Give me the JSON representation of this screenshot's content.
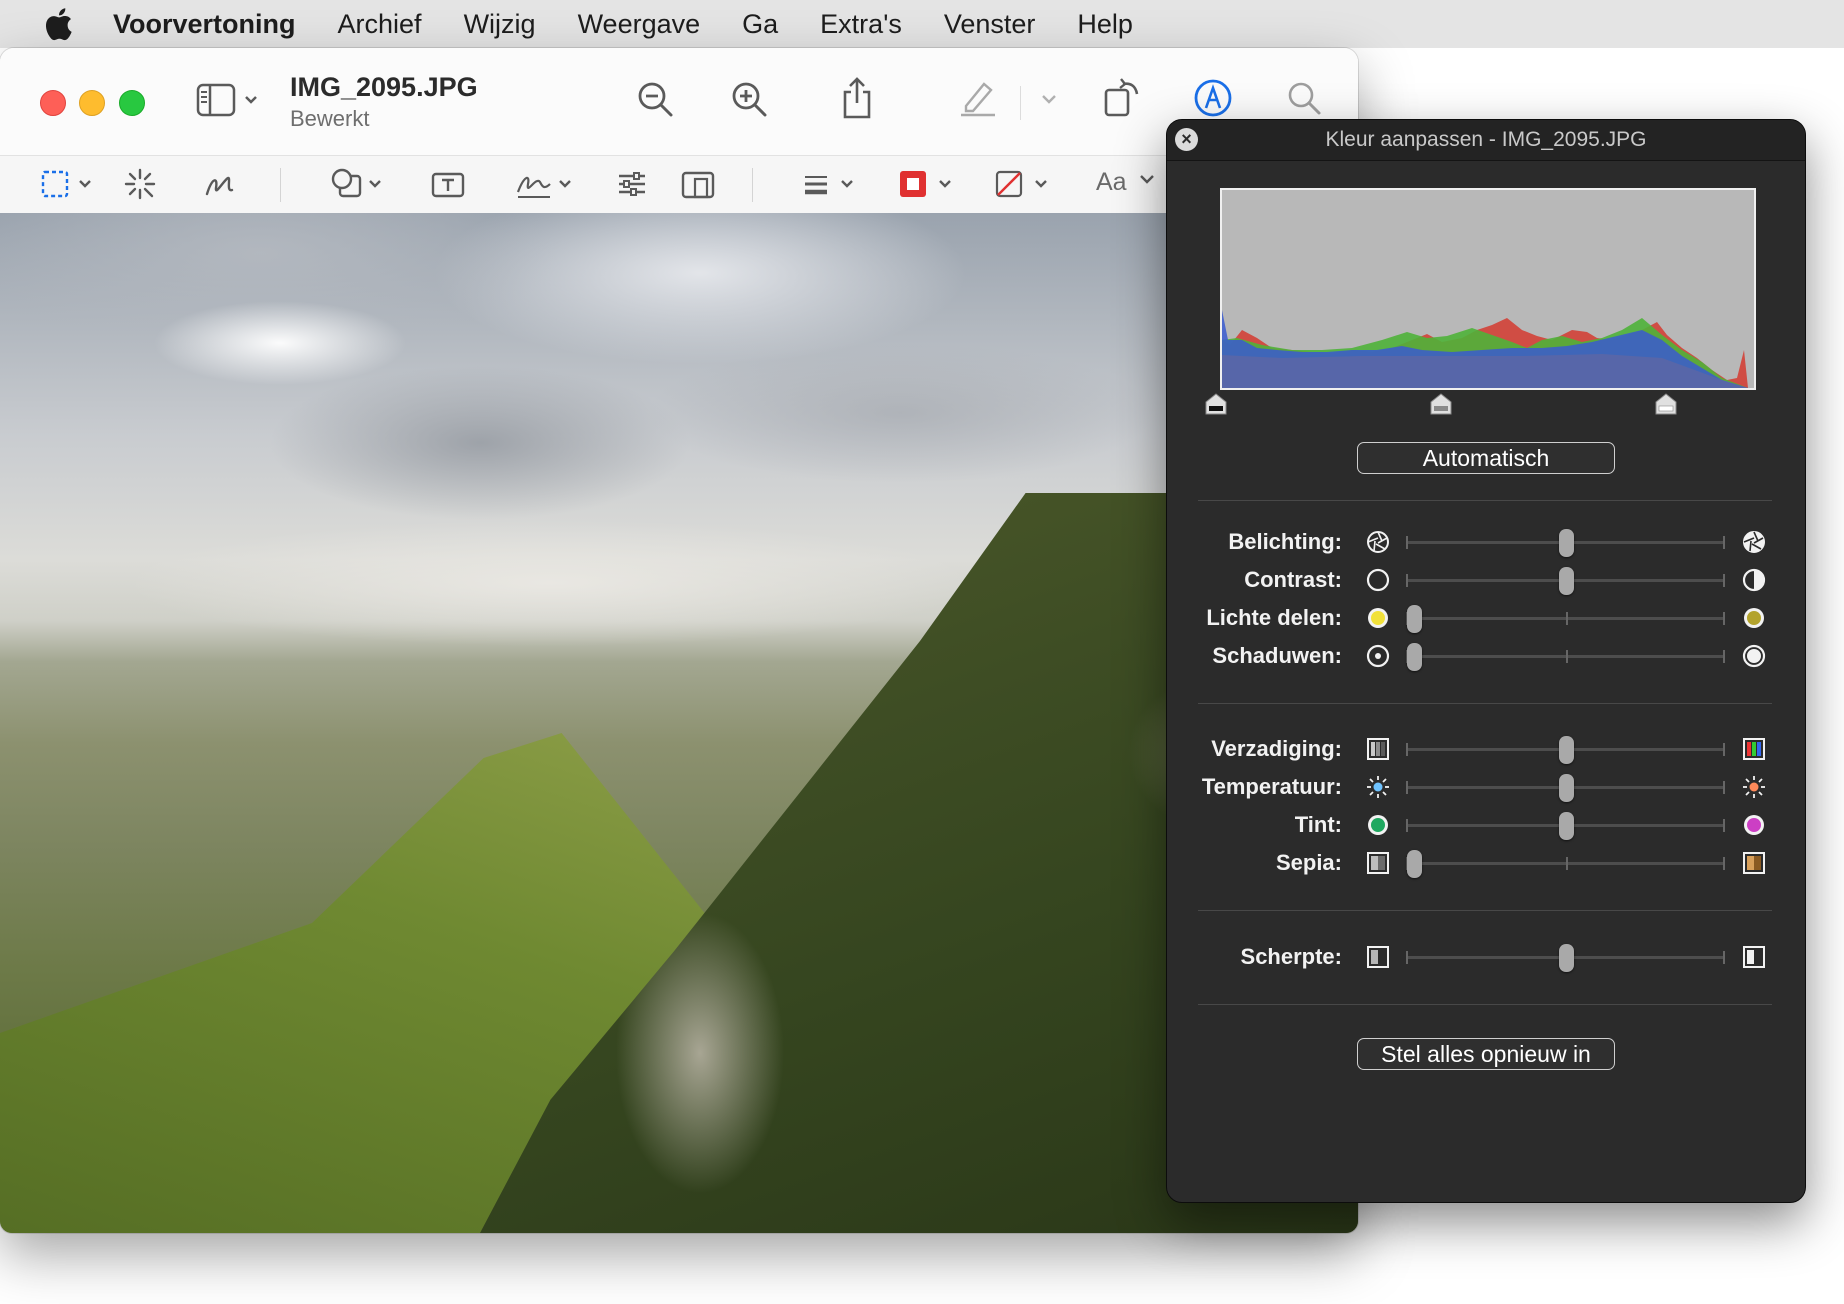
{
  "menubar": {
    "app": "Voorvertoning",
    "items": [
      "Archief",
      "Wijzig",
      "Weergave",
      "Ga",
      "Extra's",
      "Venster",
      "Help"
    ]
  },
  "window": {
    "title": "IMG_2095.JPG",
    "subtitle": "Bewerkt",
    "toolbar_icons": [
      "sidebar-icon",
      "zoom-out-icon",
      "zoom-in-icon",
      "share-icon",
      "highlight-pen-icon",
      "rotate-icon",
      "markup-icon",
      "search-icon"
    ],
    "markup_icons": [
      "rect-select-icon",
      "instant-alpha-icon",
      "sketch-icon",
      "shapes-icon",
      "text-box-icon",
      "signature-icon",
      "adjust-color-icon",
      "adjust-size-icon",
      "line-style-icon",
      "border-color-icon",
      "fill-color-icon"
    ],
    "font_label": "Aa"
  },
  "panel": {
    "title": "Kleur aanpassen - IMG_2095.JPG",
    "auto_button": "Automatisch",
    "reset_button": "Stel alles opnieuw in",
    "histogram_levels": {
      "black": 0.0,
      "mid": 0.5,
      "white": 1.0
    },
    "adjustments": [
      {
        "label": "Belichting:",
        "value": 0.5,
        "icon_left": "aperture-small-icon",
        "icon_right": "aperture-large-icon"
      },
      {
        "label": "Contrast:",
        "value": 0.5,
        "icon_left": "circle-empty-icon",
        "icon_right": "circle-half-icon"
      },
      {
        "label": "Lichte delen:",
        "value": 0.0,
        "icon_left": "circle-yellow-icon",
        "icon_right": "circle-olive-icon"
      },
      {
        "label": "Schaduwen:",
        "value": 0.0,
        "icon_left": "circle-dot-icon",
        "icon_right": "circle-white-icon"
      },
      {
        "label": "Verzadiging:",
        "value": 0.5,
        "icon_left": "saturation-gray-icon",
        "icon_right": "saturation-color-icon"
      },
      {
        "label": "Temperatuur:",
        "value": 0.5,
        "icon_left": "sun-cool-icon",
        "icon_right": "sun-warm-icon"
      },
      {
        "label": "Tint:",
        "value": 0.5,
        "icon_left": "circle-green-icon",
        "icon_right": "circle-magenta-icon"
      },
      {
        "label": "Sepia:",
        "value": 0.0,
        "icon_left": "sepia-gray-icon",
        "icon_right": "sepia-brown-icon"
      },
      {
        "label": "Scherpte:",
        "value": 0.5,
        "icon_left": "sharpness-soft-icon",
        "icon_right": "sharpness-sharp-icon"
      }
    ]
  },
  "colors": {
    "panel_bg": "#2b2b2b",
    "menubar_bg": "#e4e4e4",
    "red": "#fe5f57",
    "yellow": "#febc2e",
    "green": "#28c840",
    "markup_blue": "#1a6fe8",
    "border_red": "#e03131"
  }
}
